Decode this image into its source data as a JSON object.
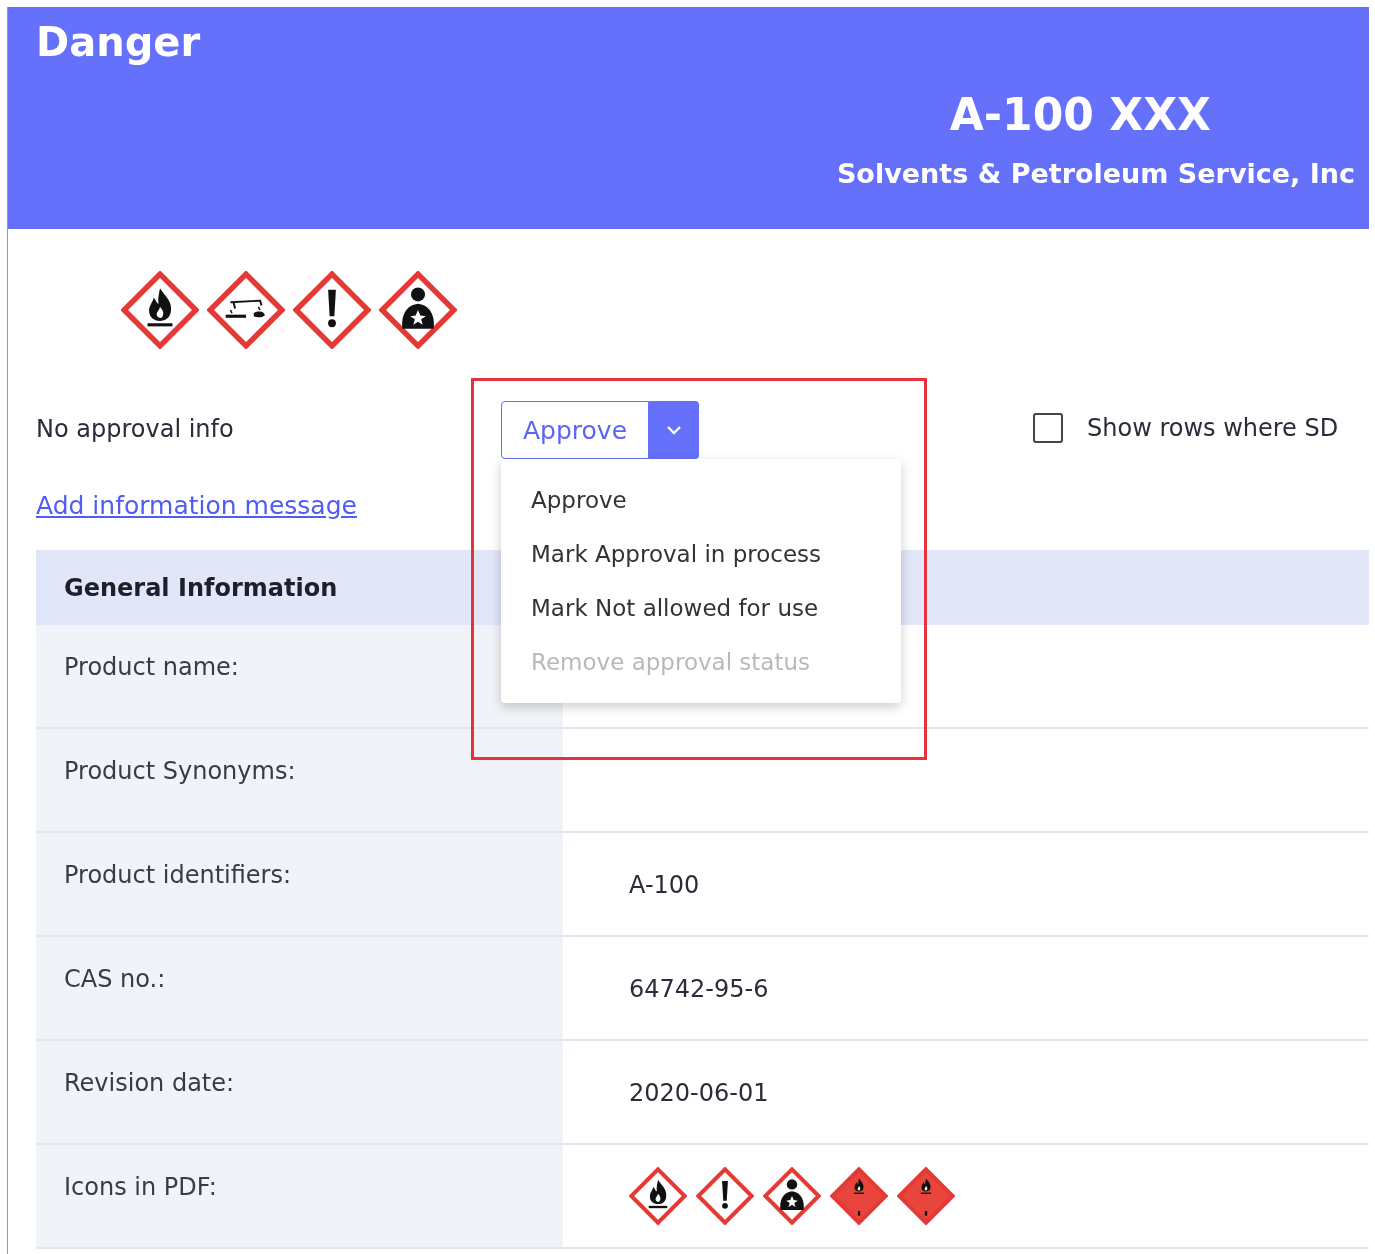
{
  "header": {
    "signal_word": "Danger",
    "product_code": "A-100 XXX",
    "supplier": "Solvents & Petroleum Service, Inc"
  },
  "hazard_icons": [
    {
      "kind": "flame"
    },
    {
      "kind": "corrosion"
    },
    {
      "kind": "exclamation"
    },
    {
      "kind": "health"
    }
  ],
  "approval": {
    "status_label": "No approval info",
    "button_label": "Approve",
    "menu_open": true,
    "menu_items": [
      {
        "label": "Approve",
        "disabled": false
      },
      {
        "label": "Mark Approval in process",
        "disabled": false
      },
      {
        "label": "Mark Not allowed for use",
        "disabled": false
      },
      {
        "label": "Remove approval status",
        "disabled": true
      }
    ],
    "highlighted": true
  },
  "filter_checkbox": {
    "label": "Show rows where SD",
    "checked": false
  },
  "add_message_link": "Add information message",
  "general_information": {
    "title": "General Information",
    "rows": [
      {
        "label": "Product name:",
        "value": ""
      },
      {
        "label": "Product Synonyms:",
        "value": ""
      },
      {
        "label": "Product identifiers:",
        "value": "A-100"
      },
      {
        "label": "CAS no.:",
        "value": "64742-95-6"
      },
      {
        "label": "Revision date:",
        "value": "2020-06-01"
      },
      {
        "label": "Icons in PDF:",
        "icons": [
          {
            "kind": "flame"
          },
          {
            "kind": "exclamation"
          },
          {
            "kind": "health"
          },
          {
            "kind": "flame-transport"
          },
          {
            "kind": "flame-transport"
          }
        ]
      }
    ]
  }
}
